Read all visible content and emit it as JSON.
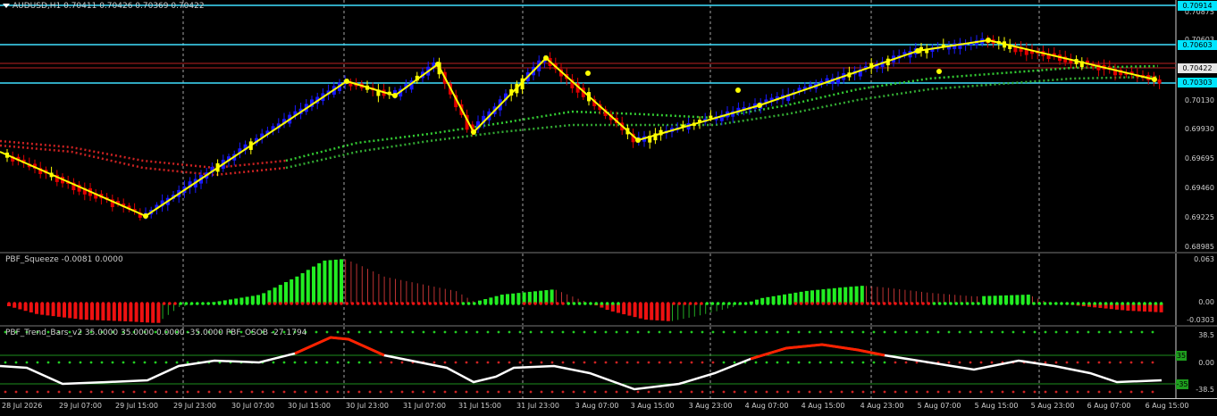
{
  "main": {
    "symbol_label": "AUDUSD,H1  0.70411 0.70426 0.70369 0.70422",
    "price_labels": [
      "0.70875",
      "0.70603",
      "0.70422",
      "0.70365",
      "0.70130",
      "0.69930",
      "0.69695",
      "0.69460",
      "0.69225",
      "0.68985"
    ],
    "tags": [
      {
        "text": "0.70914",
        "bg": "#00e5ff"
      },
      {
        "text": "0.70603",
        "bg": "#00e5ff"
      },
      {
        "text": "0.70422",
        "bg": "#e6e6e6"
      },
      {
        "text": "0.70303",
        "bg": "#00e5ff"
      }
    ]
  },
  "squeeze": {
    "label": "PBF_Squeeze -0.0081 0.0000",
    "scale": [
      "0.063",
      "0.00",
      "-0.0303"
    ]
  },
  "trend": {
    "label": "PBF_Trend_Bars_v2 35.0000 35.0000 0.0000 -35.0000  PBF_OSOB -27.1794",
    "scale": [
      "38.5",
      "0.00",
      "-38.5"
    ],
    "level_high": "35",
    "level_low": "-35"
  },
  "time_labels": [
    "28 Jul 2026",
    "29 Jul 07:00",
    "29 Jul 15:00",
    "29 Jul 23:00",
    "30 Jul 07:00",
    "30 Jul 15:00",
    "30 Jul 23:00",
    "31 Jul 07:00",
    "31 Jul 15:00",
    "31 Jul 23:00",
    "3 Aug 07:00",
    "3 Aug 15:00",
    "3 Aug 23:00",
    "4 Aug 07:00",
    "4 Aug 15:00",
    "4 Aug 23:00",
    "5 Aug 07:00",
    "5 Aug 15:00",
    "5 Aug 23:00",
    "6 Aug 07:00",
    "6 Aug 15:00"
  ],
  "colors": {
    "bull": "#1a1aff",
    "bear": "#e00000",
    "neutral": "#ffff00",
    "zigzag": "#ffff00",
    "hline": "#40e0ff",
    "squeeze_pos": "#22ee22",
    "squeeze_neg": "#ee1111",
    "osob": "#ffffff",
    "osob_hot": "#ff2200"
  },
  "chart_data": {
    "type": "candlestick",
    "symbol": "AUDUSD",
    "timeframe": "H1",
    "ohlc_current": {
      "open": 0.70411,
      "high": 0.70426,
      "low": 0.70369,
      "close": 0.70422
    },
    "horizontal_levels": [
      0.70914,
      0.70603,
      0.70303
    ],
    "zigzag": [
      0.6975,
      0.6924,
      0.7033,
      0.702,
      0.705,
      0.6995,
      0.7057,
      0.6999,
      0.704,
      0.7047,
      0.7079,
      0.7025
    ],
    "squeeze_current": -0.0081,
    "osob_current": -27.1794,
    "osob_levels": [
      35,
      0,
      -35
    ]
  }
}
